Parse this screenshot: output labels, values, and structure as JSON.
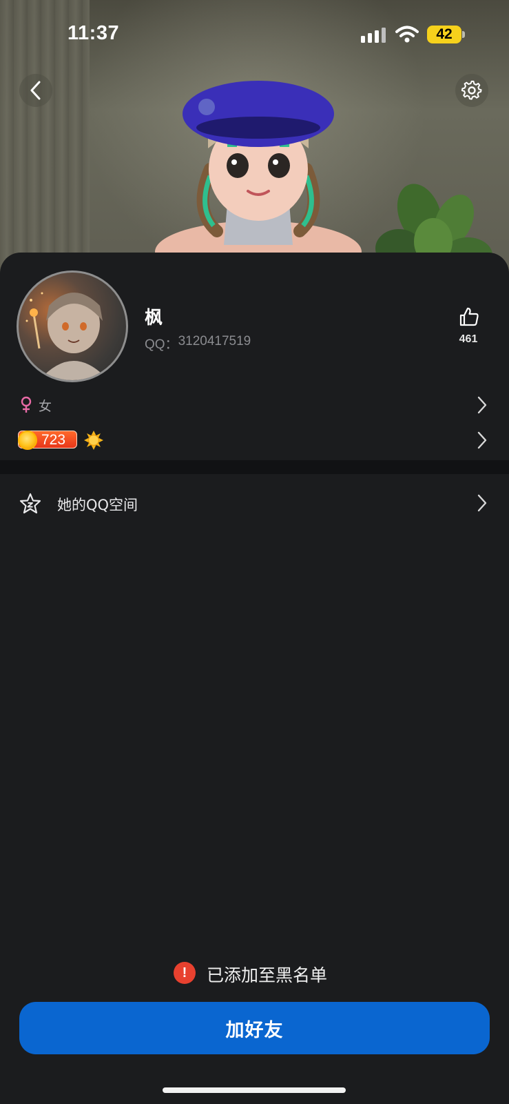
{
  "status_bar": {
    "time": "11:37",
    "battery": "42",
    "icons": [
      "signal-icon",
      "wifi-icon",
      "battery-icon"
    ]
  },
  "header": {
    "back_icon": "chevron-left-icon",
    "settings_icon": "gear-icon"
  },
  "profile": {
    "nickname": "枫",
    "qq_label": "QQ：",
    "qq_number": "3120417519",
    "likes": "461",
    "like_icon": "thumbs-up-icon"
  },
  "info_rows": {
    "gender": "女",
    "gender_icon": "female-icon",
    "level_value": "723",
    "level_icons": [
      "coin-icon",
      "sun-icon"
    ]
  },
  "menu": {
    "qzone_label": "她的QQ空间",
    "qzone_icon": "star-icon"
  },
  "notice": {
    "text": "已添加至黑名单",
    "icon_text": "!"
  },
  "actions": {
    "add_friend": "加好友"
  },
  "colors": {
    "background": "#1b1c1e",
    "button": "#0a66d0",
    "alert": "#e8412f",
    "battery": "#f6d11c",
    "gender": "#e96aa6"
  }
}
